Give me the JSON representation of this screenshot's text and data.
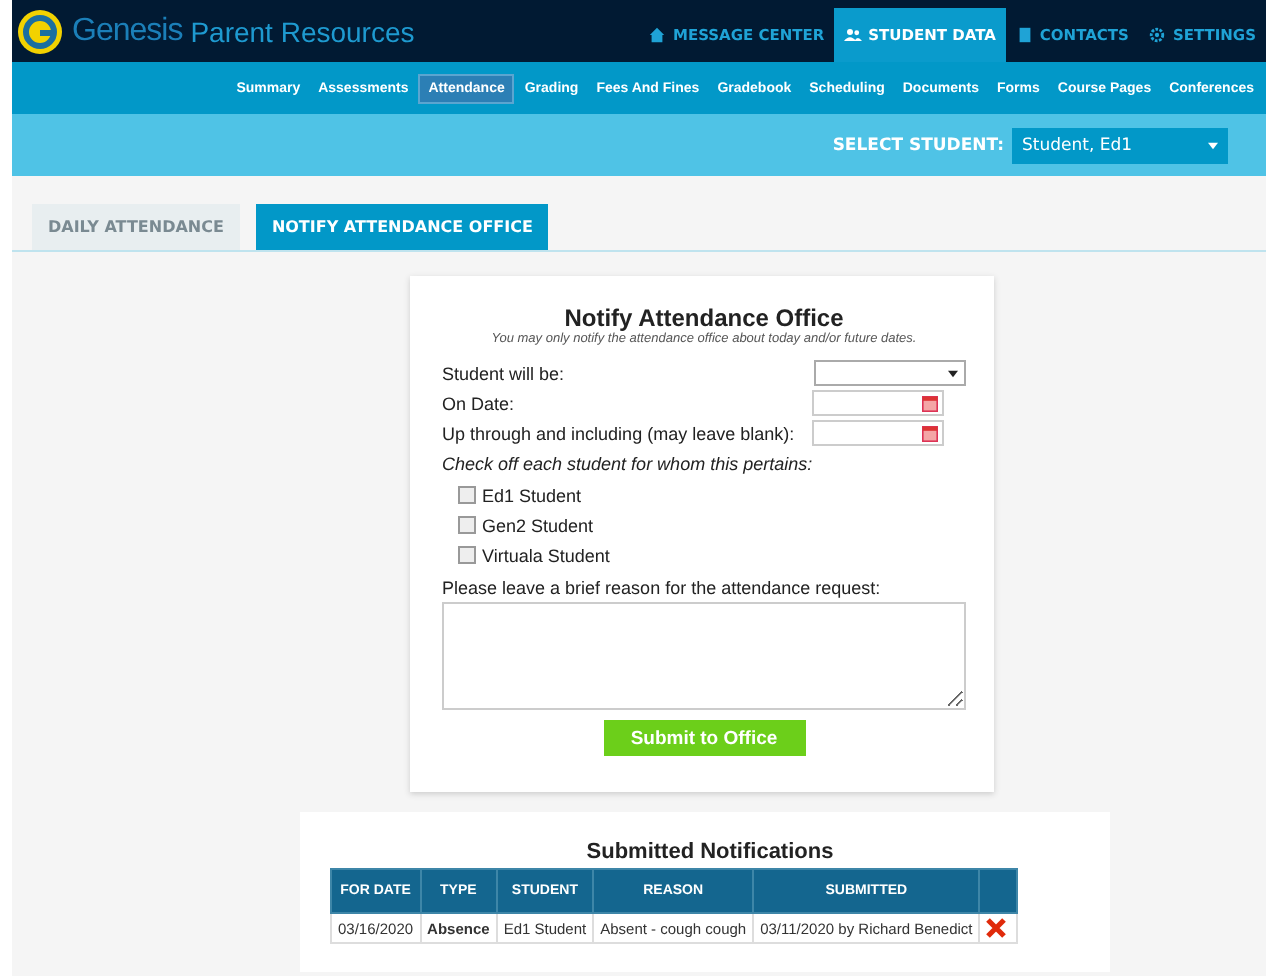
{
  "header": {
    "brand": "Genesis",
    "title": "Parent Resources",
    "nav": [
      {
        "label": "MESSAGE CENTER",
        "selected": false
      },
      {
        "label": "STUDENT DATA",
        "selected": true
      },
      {
        "label": "CONTACTS",
        "selected": false
      },
      {
        "label": "SETTINGS",
        "selected": false
      }
    ]
  },
  "subnav": [
    {
      "label": "Summary",
      "selected": false
    },
    {
      "label": "Assessments",
      "selected": false
    },
    {
      "label": "Attendance",
      "selected": true
    },
    {
      "label": "Grading",
      "selected": false
    },
    {
      "label": "Fees And Fines",
      "selected": false
    },
    {
      "label": "Gradebook",
      "selected": false
    },
    {
      "label": "Scheduling",
      "selected": false
    },
    {
      "label": "Documents",
      "selected": false
    },
    {
      "label": "Forms",
      "selected": false
    },
    {
      "label": "Course Pages",
      "selected": false
    },
    {
      "label": "Conferences",
      "selected": false
    }
  ],
  "student_select": {
    "label": "SELECT STUDENT:",
    "value": "Student, Ed1"
  },
  "tabs": [
    {
      "label": "DAILY ATTENDANCE",
      "selected": false
    },
    {
      "label": "NOTIFY ATTENDANCE OFFICE",
      "selected": true
    }
  ],
  "form": {
    "title": "Notify Attendance Office",
    "subtitle": "You may only notify the attendance office about today and/or future dates.",
    "fields": [
      {
        "label": "Student will be:",
        "kind": "select"
      },
      {
        "label": "On Date:",
        "kind": "date"
      },
      {
        "label": "Up through and including (may leave blank):",
        "kind": "date"
      }
    ],
    "students_prompt": "Check off each student for whom this pertains:",
    "students": [
      {
        "label": "Ed1 Student",
        "checked": false
      },
      {
        "label": "Gen2 Student",
        "checked": false
      },
      {
        "label": "Virtuala Student",
        "checked": false
      }
    ],
    "reason_label": "Please leave a brief reason for the attendance request:",
    "submit": "Submit to Office"
  },
  "submitted": {
    "title": "Submitted Notifications",
    "columns": [
      "FOR DATE",
      "TYPE",
      "STUDENT",
      "REASON",
      "SUBMITTED"
    ],
    "rows": [
      {
        "cells": [
          "03/16/2020",
          "Absence",
          "Ed1 Student",
          "Absent - cough cough",
          "03/11/2020 by Richard Benedict"
        ]
      }
    ]
  }
}
